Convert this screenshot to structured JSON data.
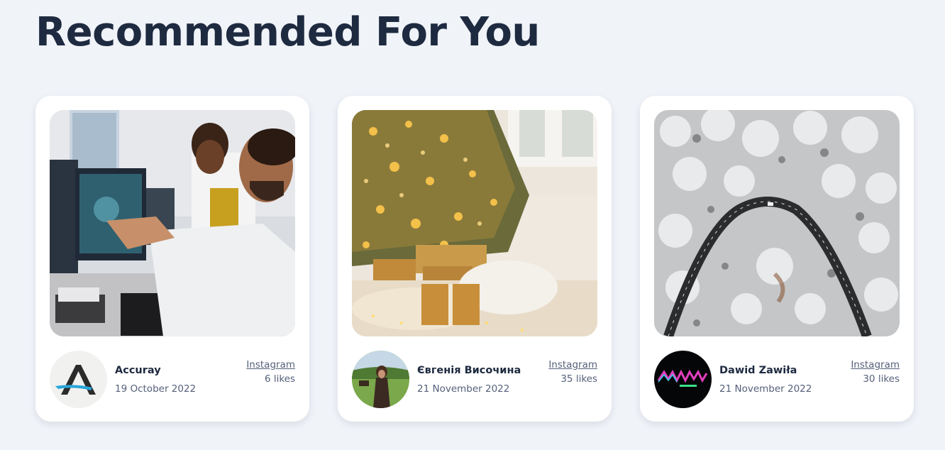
{
  "page": {
    "title": "Recommended For You"
  },
  "cards": [
    {
      "author": "Accuray",
      "date": "19 October 2022",
      "source": "Instagram",
      "likes": "6 likes",
      "image": "lab-scientists-at-monitor",
      "avatar": "accuray-logo"
    },
    {
      "author": "Євгенія Височина",
      "date": "21 November 2022",
      "source": "Instagram",
      "likes": "35 likes",
      "image": "christmas-tree-with-gifts",
      "avatar": "woman-in-field-photo"
    },
    {
      "author": "Dawid Zawiła",
      "date": "21 November 2022",
      "source": "Instagram",
      "likes": "30 likes",
      "image": "aerial-snowy-forest-road",
      "avatar": "neon-logo"
    }
  ],
  "colors": {
    "background": "#f0f3f8",
    "card": "#ffffff",
    "title": "#1e2a40",
    "muted": "#55607a"
  }
}
